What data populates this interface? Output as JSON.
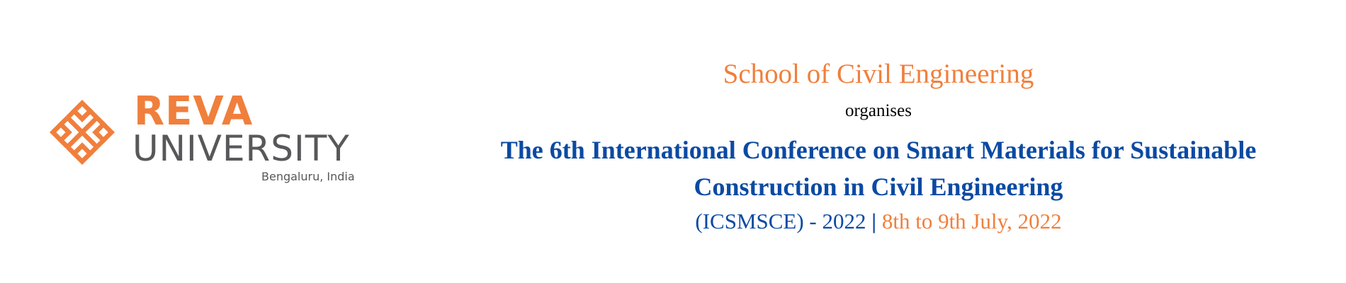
{
  "logo": {
    "name_line1": "REVA",
    "name_line2": "UNIVERSITY",
    "location": "Bengaluru, India",
    "icon": "reva-knot-icon",
    "brand_orange": "#f07f3c",
    "brand_gray": "#58585a"
  },
  "header": {
    "school": "School of Civil Engineering",
    "organises": "organises",
    "conference_title_line1": "The 6th International Conference on Smart Materials for Sustainable",
    "conference_title_line2": "Construction in Civil Engineering",
    "acronym_year": "(ICSMSCE) - 2022",
    "separator": "|",
    "dates": "8th to 9th July, 2022",
    "title_color": "#0b4aa3",
    "accent_color": "#f07f3c"
  }
}
